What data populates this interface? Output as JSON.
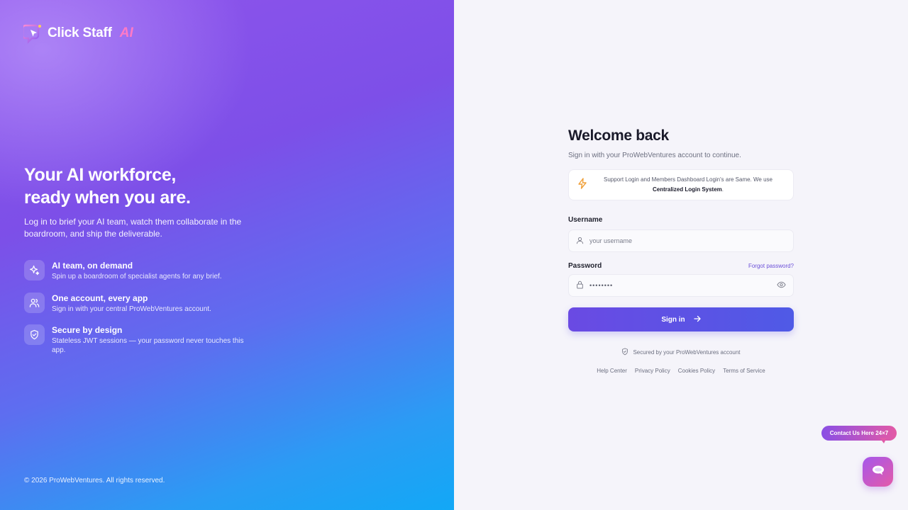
{
  "brand": {
    "name": "Click Staff",
    "suffix": "AI"
  },
  "hero": {
    "headline_line1": "Your AI workforce,",
    "headline_line2": "ready when you are.",
    "intro": "Log in to brief your AI team, watch them collaborate in the boardroom, and ship the deliverable."
  },
  "features": [
    {
      "icon": "sparkle-icon",
      "title": "AI team, on demand",
      "desc": "Spin up a boardroom of specialist agents for any brief."
    },
    {
      "icon": "users-icon",
      "title": "One account, every app",
      "desc": "Sign in with your central ProWebVentures account."
    },
    {
      "icon": "shield-check-icon",
      "title": "Secure by design",
      "desc": "Stateless JWT sessions — your password never touches this app."
    }
  ],
  "copyright": "© 2026 ProWebVentures. All rights reserved.",
  "login": {
    "title": "Welcome back",
    "subtitle": "Sign in with your ProWebVentures account to continue.",
    "notice_text": "Support Login and Members Dashboard Login's are Same. We use",
    "notice_bold": "Centralized Login System",
    "notice_end": ".",
    "username_label": "Username",
    "username_placeholder": "your username",
    "password_label": "Password",
    "forgot_label": "Forgot password?",
    "password_value": "••••••••",
    "signin_label": "Sign in",
    "secured_text": "Secured by your ProWebVentures account"
  },
  "footer_links": [
    "Help Center",
    "Privacy Policy",
    "Cookies Policy",
    "Terms of Service"
  ],
  "contact": {
    "bubble_label": "Contact Us Here 24×7"
  },
  "colors": {
    "accent": "#6a4ae3",
    "left_gradient_top": "#8f55ec",
    "left_gradient_bottom": "#12a8f6",
    "contact_gradient_start": "#8a4fe5",
    "contact_gradient_end": "#e35aa6"
  }
}
